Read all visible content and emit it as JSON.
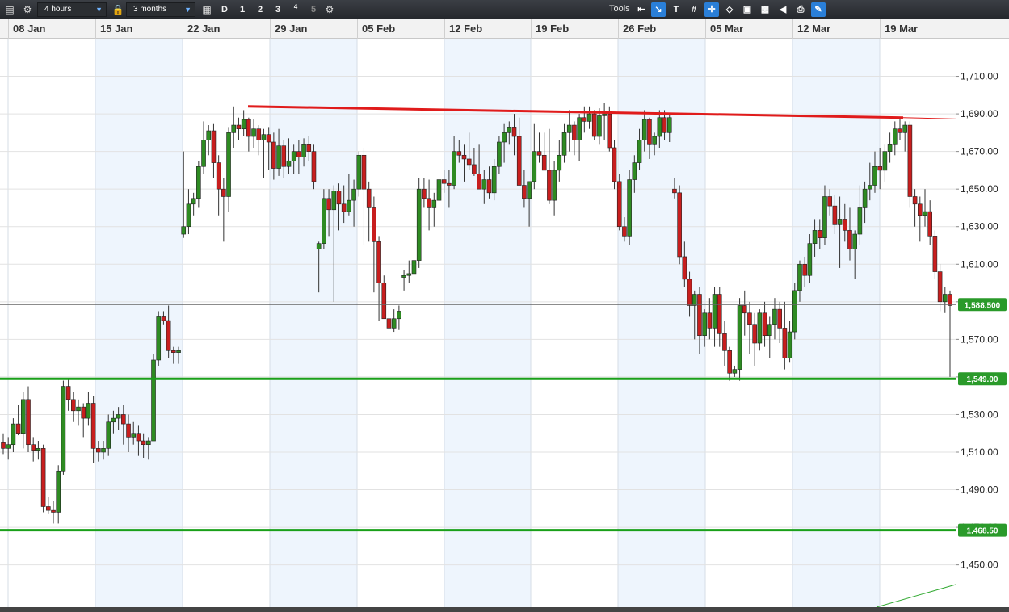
{
  "toolbar": {
    "interval": "4 hours",
    "range": "3 months",
    "buttons": [
      "D",
      "1",
      "2",
      "3",
      "4",
      "5"
    ],
    "tools_label": "Tools",
    "tool_icons": [
      "arrow-left-icon",
      "trendline-icon",
      "text-tool-icon",
      "grid-icon",
      "crosshair-icon",
      "marker-icon",
      "layers-icon",
      "chart-type-icon",
      "draw-icon",
      "print-icon",
      "settings-tool-icon"
    ]
  },
  "chart_data": {
    "type": "candlestick",
    "title": "",
    "x_tick_labels": [
      "08 Jan",
      "15 Jan",
      "22 Jan",
      "29 Jan",
      "05 Feb",
      "12 Feb",
      "19 Feb",
      "26 Feb",
      "05 Mar",
      "12 Mar",
      "19 Mar"
    ],
    "y_tick_labels": [
      "1,710.00",
      "1,690.00",
      "1,670.00",
      "1,650.00",
      "1,630.00",
      "1,610.00",
      "1,590.00",
      "1,570.00",
      "1,550.00",
      "1,530.00",
      "1,510.00",
      "1,490.00",
      "1,470.00",
      "1,450.00"
    ],
    "y_ticks": [
      1710,
      1690,
      1670,
      1650,
      1630,
      1610,
      1590,
      1570,
      1550,
      1530,
      1510,
      1490,
      1470,
      1450
    ],
    "ylim": [
      1427.5,
      1730
    ],
    "current_price_label": "1,588.500",
    "current_price": 1588.5,
    "support_lines": [
      {
        "value": 1549.0,
        "label": "1,549.00",
        "color": "#1aa01a"
      },
      {
        "value": 1468.5,
        "label": "1,468.50",
        "color": "#1aa01a"
      }
    ],
    "resistance_trendline": {
      "color": "#e01b1b",
      "from": {
        "date": "2018-01-24",
        "value": 1694
      },
      "to": {
        "date": "2018-03-19",
        "value": 1688
      }
    },
    "grid": true,
    "up_color": "#2e8b22",
    "down_color": "#c81e1e",
    "candles": [
      [
        1515,
        1520,
        1509,
        1512
      ],
      [
        1512,
        1518,
        1506,
        1514
      ],
      [
        1514,
        1528,
        1510,
        1525
      ],
      [
        1525,
        1535,
        1519,
        1520
      ],
      [
        1520,
        1542,
        1512,
        1538
      ],
      [
        1538,
        1545,
        1510,
        1514
      ],
      [
        1514,
        1518,
        1505,
        1511
      ],
      [
        1511,
        1516,
        1506,
        1512
      ],
      [
        1512,
        1514,
        1478,
        1481
      ],
      [
        1481,
        1486,
        1477,
        1479
      ],
      [
        1479,
        1484,
        1472,
        1478
      ],
      [
        1478,
        1503,
        1472,
        1500
      ],
      [
        1500,
        1548,
        1498,
        1545
      ],
      [
        1545,
        1549,
        1532,
        1538
      ],
      [
        1538,
        1542,
        1526,
        1532
      ],
      [
        1532,
        1538,
        1524,
        1534
      ],
      [
        1534,
        1536,
        1518,
        1528
      ],
      [
        1528,
        1542,
        1524,
        1536
      ],
      [
        1536,
        1540,
        1504,
        1512
      ],
      [
        1512,
        1516,
        1505,
        1510
      ],
      [
        1510,
        1516,
        1506,
        1512
      ],
      [
        1512,
        1530,
        1508,
        1526
      ],
      [
        1526,
        1532,
        1520,
        1528
      ],
      [
        1528,
        1534,
        1522,
        1530
      ],
      [
        1530,
        1535,
        1514,
        1525
      ],
      [
        1525,
        1530,
        1510,
        1518
      ],
      [
        1518,
        1526,
        1514,
        1520
      ],
      [
        1520,
        1524,
        1508,
        1516
      ],
      [
        1516,
        1520,
        1507,
        1514
      ],
      [
        1514,
        1518,
        1506,
        1516
      ],
      [
        1516,
        1562,
        1538,
        1559
      ],
      [
        1559,
        1585,
        1556,
        1582
      ],
      [
        1582,
        1585,
        1578,
        1580
      ],
      [
        1580,
        1588,
        1560,
        1564
      ],
      [
        1564,
        1566,
        1557,
        1563
      ],
      [
        1563,
        1566,
        1557,
        1564
      ],
      [
        1626,
        1670,
        1624,
        1630
      ],
      [
        1630,
        1650,
        1626,
        1642
      ],
      [
        1642,
        1648,
        1636,
        1645
      ],
      [
        1645,
        1665,
        1640,
        1662
      ],
      [
        1662,
        1686,
        1658,
        1676
      ],
      [
        1676,
        1684,
        1668,
        1681
      ],
      [
        1681,
        1685,
        1656,
        1664
      ],
      [
        1664,
        1668,
        1636,
        1650
      ],
      [
        1650,
        1656,
        1622,
        1646
      ],
      [
        1646,
        1683,
        1638,
        1680
      ],
      [
        1680,
        1694,
        1672,
        1684
      ],
      [
        1684,
        1688,
        1676,
        1682
      ],
      [
        1682,
        1692,
        1678,
        1687
      ],
      [
        1687,
        1688,
        1670,
        1678
      ],
      [
        1678,
        1687,
        1672,
        1682
      ],
      [
        1682,
        1684,
        1668,
        1676
      ],
      [
        1676,
        1682,
        1656,
        1679
      ],
      [
        1679,
        1683,
        1660,
        1675
      ],
      [
        1675,
        1680,
        1655,
        1661
      ],
      [
        1661,
        1682,
        1657,
        1673
      ],
      [
        1673,
        1676,
        1656,
        1662
      ],
      [
        1662,
        1677,
        1658,
        1665
      ],
      [
        1665,
        1674,
        1658,
        1670
      ],
      [
        1670,
        1676,
        1658,
        1667
      ],
      [
        1667,
        1677,
        1662,
        1674
      ],
      [
        1674,
        1678,
        1665,
        1670
      ],
      [
        1670,
        1674,
        1650,
        1654
      ],
      [
        1618,
        1622,
        1595,
        1621
      ],
      [
        1621,
        1650,
        1618,
        1645
      ],
      [
        1645,
        1650,
        1625,
        1639
      ],
      [
        1639,
        1652,
        1590,
        1649
      ],
      [
        1649,
        1653,
        1628,
        1642
      ],
      [
        1642,
        1652,
        1632,
        1638
      ],
      [
        1638,
        1658,
        1636,
        1644
      ],
      [
        1644,
        1655,
        1630,
        1650
      ],
      [
        1650,
        1670,
        1646,
        1668
      ],
      [
        1668,
        1672,
        1620,
        1650
      ],
      [
        1650,
        1654,
        1622,
        1640
      ],
      [
        1640,
        1646,
        1595,
        1622
      ],
      [
        1622,
        1625,
        1580,
        1600
      ],
      [
        1600,
        1604,
        1586,
        1581
      ],
      [
        1581,
        1586,
        1575,
        1576
      ],
      [
        1576,
        1586,
        1574,
        1581
      ],
      [
        1581,
        1588,
        1575,
        1585
      ],
      [
        1603,
        1607,
        1596,
        1604
      ],
      [
        1604,
        1612,
        1600,
        1605
      ],
      [
        1605,
        1618,
        1602,
        1612
      ],
      [
        1612,
        1656,
        1608,
        1650
      ],
      [
        1650,
        1656,
        1640,
        1645
      ],
      [
        1645,
        1655,
        1628,
        1640
      ],
      [
        1640,
        1648,
        1630,
        1644
      ],
      [
        1644,
        1658,
        1638,
        1655
      ],
      [
        1655,
        1660,
        1648,
        1653
      ],
      [
        1653,
        1660,
        1640,
        1652
      ],
      [
        1652,
        1678,
        1650,
        1670
      ],
      [
        1670,
        1676,
        1664,
        1668
      ],
      [
        1668,
        1674,
        1654,
        1666
      ],
      [
        1666,
        1680,
        1660,
        1663
      ],
      [
        1663,
        1672,
        1657,
        1658
      ],
      [
        1658,
        1674,
        1652,
        1650
      ],
      [
        1650,
        1660,
        1642,
        1655
      ],
      [
        1655,
        1662,
        1645,
        1648
      ],
      [
        1648,
        1666,
        1644,
        1662
      ],
      [
        1662,
        1678,
        1658,
        1675
      ],
      [
        1675,
        1685,
        1664,
        1680
      ],
      [
        1680,
        1686,
        1674,
        1683
      ],
      [
        1683,
        1690,
        1668,
        1678
      ],
      [
        1678,
        1688,
        1652,
        1652
      ],
      [
        1652,
        1660,
        1640,
        1645
      ],
      [
        1645,
        1654,
        1630,
        1654
      ],
      [
        1654,
        1685,
        1650,
        1670
      ],
      [
        1670,
        1680,
        1664,
        1668
      ],
      [
        1668,
        1680,
        1660,
        1660
      ],
      [
        1660,
        1682,
        1642,
        1644
      ],
      [
        1644,
        1665,
        1636,
        1660
      ],
      [
        1660,
        1676,
        1654,
        1668
      ],
      [
        1668,
        1685,
        1664,
        1680
      ],
      [
        1680,
        1692,
        1670,
        1684
      ],
      [
        1684,
        1686,
        1668,
        1676
      ],
      [
        1676,
        1690,
        1665,
        1688
      ],
      [
        1688,
        1694,
        1680,
        1686
      ],
      [
        1686,
        1694,
        1682,
        1690
      ],
      [
        1690,
        1692,
        1676,
        1678
      ],
      [
        1678,
        1693,
        1674,
        1689
      ],
      [
        1689,
        1696,
        1676,
        1690
      ],
      [
        1690,
        1694,
        1670,
        1672
      ],
      [
        1672,
        1676,
        1650,
        1654
      ],
      [
        1654,
        1658,
        1628,
        1630
      ],
      [
        1630,
        1635,
        1622,
        1625
      ],
      [
        1625,
        1660,
        1620,
        1655
      ],
      [
        1655,
        1668,
        1648,
        1664
      ],
      [
        1664,
        1682,
        1660,
        1676
      ],
      [
        1676,
        1692,
        1670,
        1687
      ],
      [
        1687,
        1688,
        1666,
        1674
      ],
      [
        1674,
        1680,
        1668,
        1678
      ],
      [
        1678,
        1692,
        1672,
        1688
      ],
      [
        1688,
        1692,
        1676,
        1680
      ],
      [
        1680,
        1690,
        1675,
        1688
      ],
      [
        1650,
        1656,
        1645,
        1648
      ],
      [
        1648,
        1652,
        1610,
        1614
      ],
      [
        1614,
        1622,
        1598,
        1602
      ],
      [
        1602,
        1606,
        1582,
        1588
      ],
      [
        1588,
        1596,
        1570,
        1594
      ],
      [
        1594,
        1598,
        1562,
        1572
      ],
      [
        1572,
        1586,
        1566,
        1584
      ],
      [
        1584,
        1592,
        1570,
        1576
      ],
      [
        1576,
        1598,
        1566,
        1594
      ],
      [
        1594,
        1598,
        1566,
        1573
      ],
      [
        1573,
        1580,
        1556,
        1564
      ],
      [
        1564,
        1566,
        1548,
        1552
      ],
      [
        1552,
        1556,
        1550,
        1554
      ],
      [
        1554,
        1592,
        1548,
        1588
      ],
      [
        1588,
        1596,
        1572,
        1584
      ],
      [
        1584,
        1590,
        1562,
        1578
      ],
      [
        1578,
        1584,
        1556,
        1568
      ],
      [
        1568,
        1586,
        1564,
        1584
      ],
      [
        1584,
        1590,
        1566,
        1572
      ],
      [
        1572,
        1582,
        1560,
        1578
      ],
      [
        1578,
        1592,
        1570,
        1586
      ],
      [
        1586,
        1590,
        1568,
        1576
      ],
      [
        1576,
        1590,
        1554,
        1560
      ],
      [
        1560,
        1580,
        1558,
        1574
      ],
      [
        1574,
        1600,
        1570,
        1596
      ],
      [
        1596,
        1612,
        1590,
        1610
      ],
      [
        1610,
        1614,
        1598,
        1604
      ],
      [
        1604,
        1626,
        1600,
        1621
      ],
      [
        1621,
        1634,
        1614,
        1628
      ],
      [
        1628,
        1634,
        1618,
        1624
      ],
      [
        1624,
        1652,
        1620,
        1646
      ],
      [
        1646,
        1650,
        1636,
        1641
      ],
      [
        1641,
        1647,
        1626,
        1631
      ],
      [
        1631,
        1646,
        1608,
        1634
      ],
      [
        1634,
        1642,
        1622,
        1628
      ],
      [
        1628,
        1640,
        1612,
        1618
      ],
      [
        1618,
        1628,
        1602,
        1626
      ],
      [
        1626,
        1652,
        1620,
        1640
      ],
      [
        1640,
        1654,
        1632,
        1650
      ],
      [
        1650,
        1664,
        1644,
        1652
      ],
      [
        1652,
        1670,
        1648,
        1662
      ],
      [
        1662,
        1672,
        1650,
        1660
      ],
      [
        1660,
        1674,
        1654,
        1670
      ],
      [
        1670,
        1680,
        1664,
        1674
      ],
      [
        1674,
        1686,
        1668,
        1682
      ],
      [
        1682,
        1688,
        1676,
        1680
      ],
      [
        1680,
        1686,
        1670,
        1684
      ],
      [
        1684,
        1686,
        1640,
        1646
      ],
      [
        1646,
        1650,
        1630,
        1642
      ],
      [
        1642,
        1646,
        1622,
        1636
      ],
      [
        1636,
        1650,
        1630,
        1638
      ],
      [
        1638,
        1644,
        1620,
        1625
      ],
      [
        1625,
        1628,
        1602,
        1606
      ],
      [
        1606,
        1610,
        1585,
        1590
      ],
      [
        1590,
        1598,
        1584,
        1594
      ],
      [
        1594,
        1596,
        1550,
        1588
      ]
    ]
  }
}
